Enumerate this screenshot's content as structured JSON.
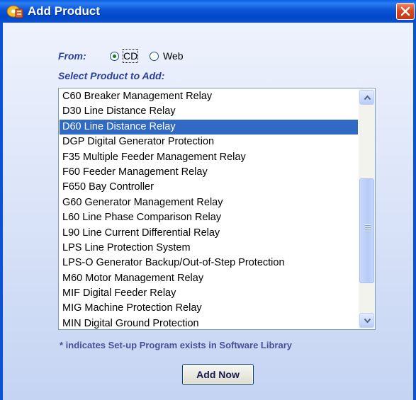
{
  "window": {
    "title": "Add Product",
    "icon": "add-product-app-icon",
    "close_icon": "close-icon"
  },
  "source": {
    "label": "From:",
    "options": [
      {
        "label": "CD",
        "checked": true
      },
      {
        "label": "Web",
        "checked": false
      }
    ]
  },
  "product_list": {
    "label": "Select Product to Add:",
    "selected": "D60 Line Distance Relay",
    "items": [
      "C60 Breaker Management Relay",
      "D30 Line Distance Relay",
      "D60 Line Distance Relay",
      "DGP Digital Generator Protection",
      "F35 Multiple Feeder Management Relay",
      "F60 Feeder Management Relay",
      "F650 Bay Controller",
      "G60 Generator Management Relay",
      "L60 Line Phase Comparison Relay",
      "L90 Line Current Differential Relay",
      "LPS Line Protection System",
      "LPS-O Generator Backup/Out-of-Step Protection",
      "M60 Motor Management Relay",
      "MIF Digital Feeder Relay",
      "MIG Machine Protection Relay",
      "MIN Digital Ground Protection"
    ],
    "scrollbar": {
      "up_icon": "chevron-up-icon",
      "down_icon": "chevron-down-icon"
    }
  },
  "footnote": "* indicates Set-up Program exists in Software Library",
  "add_button": {
    "label": "Add Now"
  },
  "colors": {
    "titlebar": "#0a54d8",
    "selection": "#316ac5",
    "label_text": "#2a3f9a"
  }
}
